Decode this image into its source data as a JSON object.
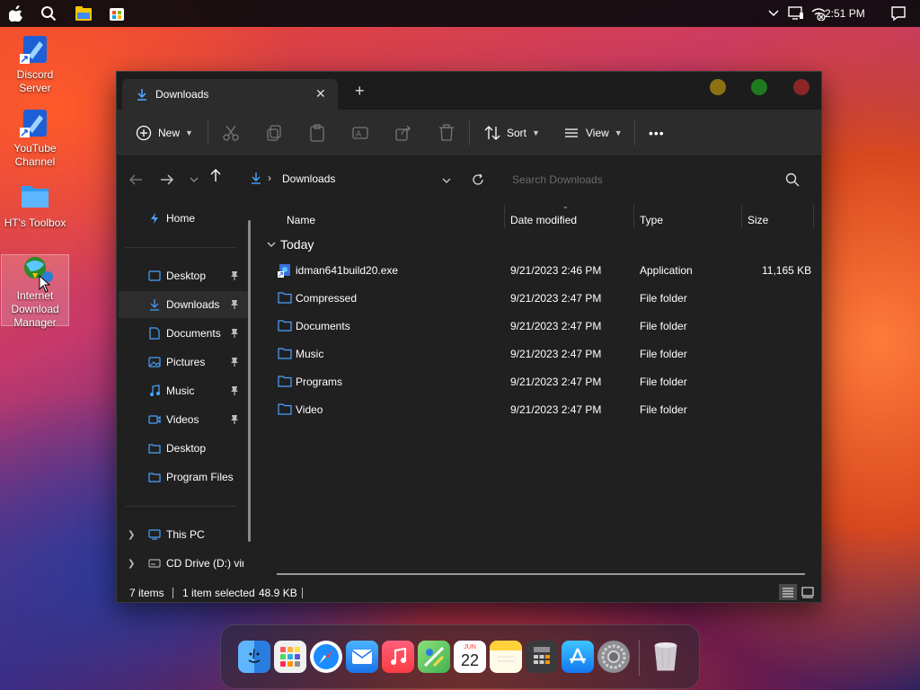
{
  "menubar": {
    "time": "2:51 PM",
    "icons": [
      "apple-icon",
      "search-icon",
      "file-explorer-icon",
      "store-icon",
      "chevron-up-icon",
      "display-icon",
      "wifi-off-icon",
      "notification-icon"
    ]
  },
  "desktop": {
    "icons": [
      {
        "label": "Discord Server",
        "icon": "shortcut-icon"
      },
      {
        "label": "YouTube Channel",
        "icon": "shortcut-icon"
      },
      {
        "label": "HT's Toolbox",
        "icon": "folder-icon"
      },
      {
        "label": "Internet Download Manager",
        "icon": "idm-icon"
      }
    ]
  },
  "window": {
    "tab_title": "Downloads",
    "toolbar": {
      "new_label": "New",
      "sort_label": "Sort",
      "view_label": "View",
      "more_label": "•••"
    },
    "address": {
      "path": "Downloads",
      "search_placeholder": "Search Downloads"
    },
    "sidebar": {
      "home": "Home",
      "items": [
        {
          "label": "Desktop",
          "pinned": true
        },
        {
          "label": "Downloads",
          "pinned": true,
          "active": true
        },
        {
          "label": "Documents",
          "pinned": true
        },
        {
          "label": "Pictures",
          "pinned": true
        },
        {
          "label": "Music",
          "pinned": true
        },
        {
          "label": "Videos",
          "pinned": true
        },
        {
          "label": "Desktop",
          "pinned": false
        },
        {
          "label": "Program Files",
          "pinned": false
        }
      ],
      "this_pc": "This PC",
      "cd_drive": "CD Drive (D:) vir"
    },
    "columns": {
      "name": "Name",
      "date": "Date modified",
      "type": "Type",
      "size": "Size"
    },
    "group": "Today",
    "files": [
      {
        "name": "idman641build20.exe",
        "date": "9/21/2023 2:46 PM",
        "type": "Application",
        "size": "11,165 KB",
        "icon": "application-icon"
      },
      {
        "name": "Compressed",
        "date": "9/21/2023 2:47 PM",
        "type": "File folder",
        "size": "",
        "icon": "folder-icon"
      },
      {
        "name": "Documents",
        "date": "9/21/2023 2:47 PM",
        "type": "File folder",
        "size": "",
        "icon": "folder-icon"
      },
      {
        "name": "Music",
        "date": "9/21/2023 2:47 PM",
        "type": "File folder",
        "size": "",
        "icon": "folder-icon"
      },
      {
        "name": "Programs",
        "date": "9/21/2023 2:47 PM",
        "type": "File folder",
        "size": "",
        "icon": "folder-icon"
      },
      {
        "name": "Video",
        "date": "9/21/2023 2:47 PM",
        "type": "File folder",
        "size": "",
        "icon": "folder-icon"
      }
    ],
    "status": {
      "items": "7 items",
      "selected": "1 item selected",
      "size": "48.9 KB"
    }
  },
  "dock": {
    "calendar_month": "JUN",
    "calendar_day": "22",
    "apps": [
      "finder-icon",
      "launchpad-icon",
      "safari-icon",
      "mail-icon",
      "music-icon",
      "maps-icon",
      "calendar-icon",
      "notes-icon",
      "calculator-icon",
      "app-store-icon",
      "system-settings-icon",
      "trash-icon"
    ]
  },
  "colors": {
    "window_bg": "#202020",
    "toolbar_bg": "#2c2c2c",
    "accent": "#4aa3ff",
    "folder": "#4aa3ff",
    "traffic_yellow": "#8c7214",
    "traffic_green": "#1f7a1f",
    "traffic_red": "#8a2626"
  }
}
